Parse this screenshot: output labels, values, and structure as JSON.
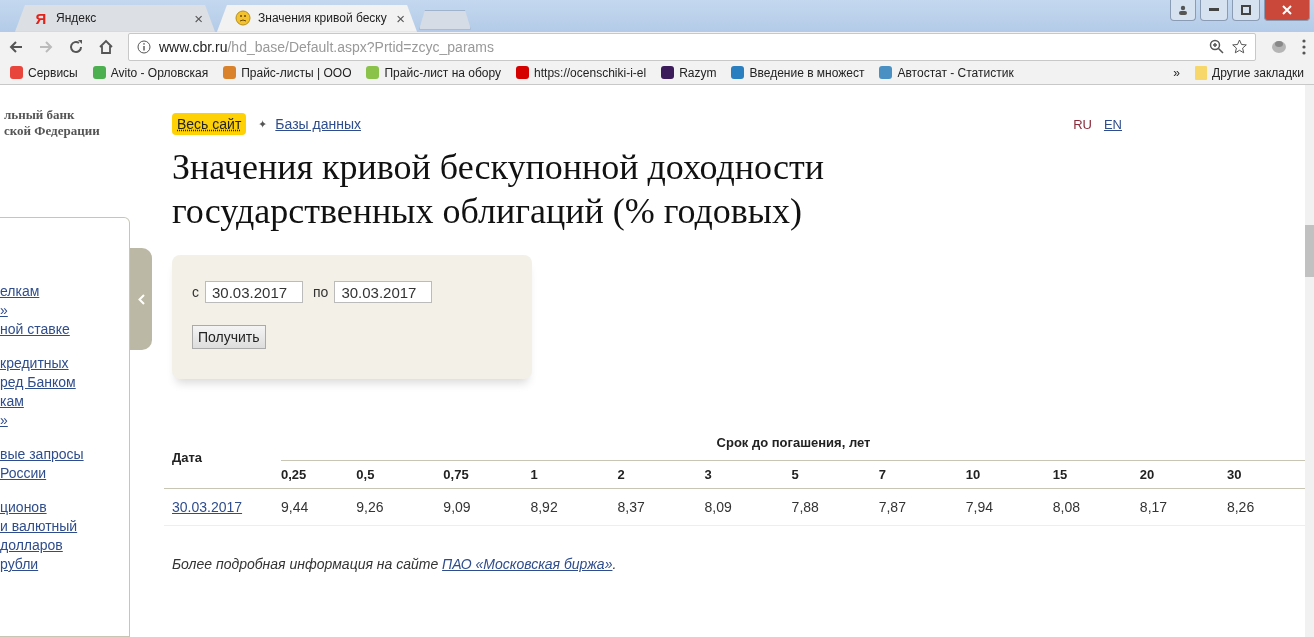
{
  "browser": {
    "tabs": [
      {
        "kind": "letter",
        "title": "Яндекс",
        "icon": "Я",
        "selected": false,
        "close": "×"
      },
      {
        "kind": "smiley",
        "title": "Значения кривой беску",
        "selected": true,
        "close": "×"
      }
    ],
    "url_host": "www.cbr.ru",
    "url_path": "/hd_base/Default.aspx?Prtid=zcyc_params",
    "bookmarks": [
      {
        "label": "Сервисы",
        "color": "#e8453c"
      },
      {
        "label": "Avito - Орловская",
        "color": "#4caf50"
      },
      {
        "label": "Прайс-листы | ООО",
        "color": "#d9822b"
      },
      {
        "label": "Прайс-лист на обору",
        "color": "#8bc34a"
      },
      {
        "label": "https://ocenschiki-i-el",
        "color": "#d50000"
      },
      {
        "label": "Razym",
        "color": "#3b1b5a"
      },
      {
        "label": "Введение в множест",
        "color": "#2a7fc1"
      },
      {
        "label": "Автостат - Статистик",
        "color": "#4a90c2"
      }
    ],
    "more": "»",
    "other_bookmarks": "Другие закладки"
  },
  "sidebar": {
    "bank_name": [
      "льный банк",
      "ской Федерации"
    ],
    "link_groups": [
      [
        "елкам",
        "»",
        "ной ставке"
      ],
      [
        "кредитных",
        "ред Банком",
        "кам",
        "»"
      ],
      [
        "вые запросы",
        "России"
      ],
      [
        "ционов",
        "и валютный",
        "долларов",
        "рубли"
      ]
    ]
  },
  "breadcrumbs": {
    "site": "Весь сайт",
    "separator": "✦",
    "section": "Базы данных"
  },
  "languages": [
    {
      "label": "RU",
      "selected": true
    },
    {
      "label": "EN",
      "selected": false
    }
  ],
  "title": "Значения кривой бескупонной доходности государственных облигаций (% годовых)",
  "form": {
    "from_label": "с",
    "from_value": "30.03.2017",
    "to_label": "по",
    "to_value": "30.03.2017",
    "button": "Получить"
  },
  "table": {
    "date_header": "Дата",
    "group_header": "Срок до погашения, лет",
    "columns": [
      "0,25",
      "0,5",
      "0,75",
      "1",
      "2",
      "3",
      "5",
      "7",
      "10",
      "15",
      "20",
      "30"
    ],
    "rows": [
      {
        "date": "30.03.2017",
        "values": [
          "9,44",
          "9,26",
          "9,09",
          "8,92",
          "8,37",
          "8,09",
          "7,88",
          "7,87",
          "7,94",
          "8,08",
          "8,17",
          "8,26"
        ]
      }
    ]
  },
  "footnote": {
    "text": "Более подробная информация на сайте",
    "link": "ПАО «Московская биржа»",
    "end": "."
  }
}
